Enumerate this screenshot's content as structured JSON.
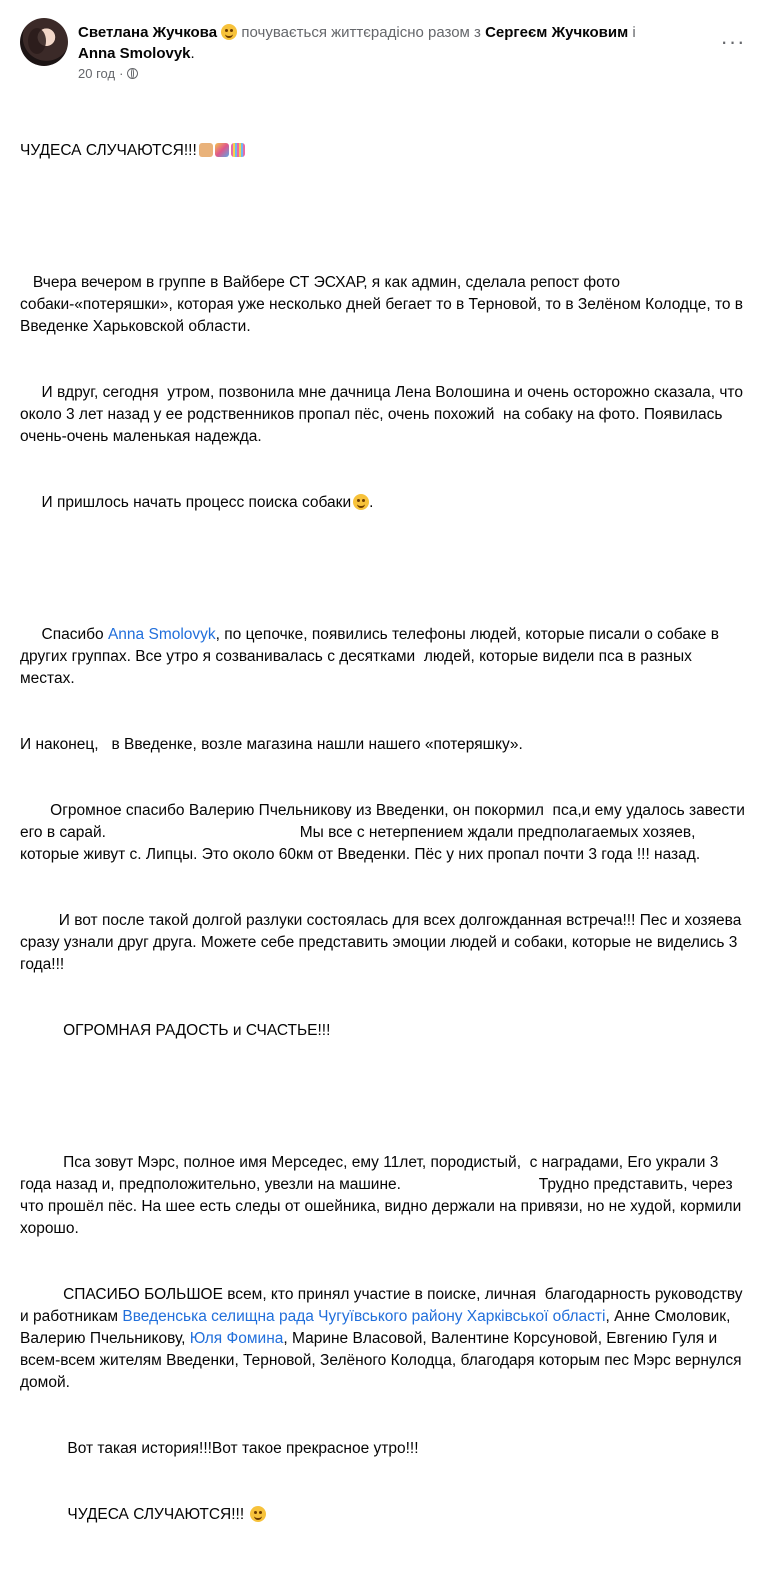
{
  "header": {
    "author": "Светлана Жучкова",
    "feeling_text": "почувається життєрадісно разом з",
    "tag1": "Сергеєм Жучковим",
    "conj": "і",
    "tag2": "Anna Smolovyk",
    "period": ".",
    "time": "20 год",
    "dot": "·",
    "more_label": "···"
  },
  "post": {
    "title": "ЧУДЕСА СЛУЧАЮТСЯ!!!",
    "p1": "   Вчера вечером в группе в Вайбере СТ ЭСХАР, я как админ, сделала репост фото собаки-«потеряшки», которая уже несколько дней бегает то в Терновой, то в Зелёном Колодце, то в Введенке Харьковской области.",
    "p2": "     И вдруг, сегодня  утром, позвонила мне дачница Лена Волошина и очень осторожно сказала, что около 3 лет назад у ее родственников пропал пёс, очень похожий  на собаку на фото. Появилась очень-очень маленькая надежда.",
    "p3": "     И пришлось начать процесс поиска собаки",
    "p4a": "     Спасибо ",
    "p4link": "Anna Smolovyk",
    "p4b": ", по цепочке, появились телефоны людей, которые писали о собаке в других группах. Все утро я созванивалась с десятками  людей, которые видели пса в разных местах.",
    "p5": "И наконец,   в Введенке, возле магазина нашли нашего «потеряшку».",
    "p6": "       Огромное спасибо Валерию Пчельникову из Введенки, он покормил  пса,и ему удалось завести  его в сарай.                                             Мы все с нетерпением ждали предполагаемых хозяев, которые живут с. Липцы. Это около 60км от Введенки. Пёс у них пропал почти 3 года !!! назад.",
    "p7": "         И вот после такой долгой разлуки состоялась для всех долгожданная встреча!!! Пес и хозяева сразу узнали друг друга. Можете себе представить эмоции людей и собаки, которые не виделись 3 года!!!",
    "p8": "          ОГРОМНАЯ РАДОСТЬ и СЧАСТЬЕ!!!",
    "p9": "          Пса зовут Мэрс, полное имя Мерседес, ему 11лет, породистый,  с наградами, Его украли 3 года назад и, предположительно, увезли на машине.                                Трудно представить, через что прошёл пёс. На шее есть следы от ошейника, видно держали на привязи, но не худой, кормили хорошо.",
    "p10a": "          СПАСИБО БОЛЬШОЕ всем, кто принял участие в поиске, личная  благодарность руководству и работникам ",
    "p10link1": "Введенська селищна рада Чугуївського району Харківської області",
    "p10b": ", Анне Смоловик, Валерию Пчельникову, ",
    "p10link2": "Юля Фомина",
    "p10c": ", Марине Власовой, Валентине Корсуновой, Евгению Гуля и всем-всем жителям Введенки, Терновой, Зелёного Колодца, благодаря которым пес Мэрс вернулся домой.",
    "p11": "           Вот такая история!!!Вот такое прекрасное утро!!!",
    "p12": "           ЧУДЕСА СЛУЧАЮТСЯ!!! "
  },
  "colors": {
    "link": "#216fdb",
    "muted": "#65676b",
    "text": "#050505"
  }
}
